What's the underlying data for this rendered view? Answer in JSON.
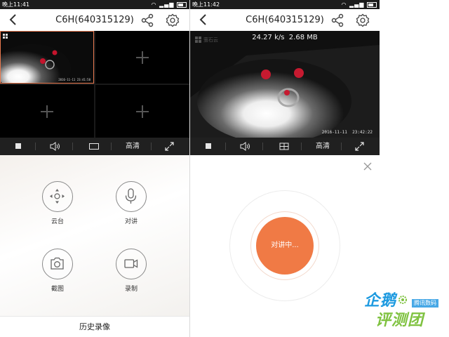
{
  "left_screen": {
    "status": {
      "time": "晚上11:41"
    },
    "header": {
      "title": "C6H(640315129)"
    },
    "video_grid": {
      "timestamp": "2016-11-11 23:41:58"
    },
    "toolbar": {
      "quality_label": "高清"
    },
    "controls": [
      {
        "label": "云台",
        "icon": "ptz-direction-icon"
      },
      {
        "label": "对讲",
        "icon": "microphone-icon"
      },
      {
        "label": "截图",
        "icon": "camera-icon"
      },
      {
        "label": "录制",
        "icon": "video-record-icon"
      }
    ],
    "history_label": "历史录像"
  },
  "right_screen": {
    "status": {
      "time": "晚上11:42"
    },
    "header": {
      "title": "C6H(640315129)"
    },
    "video": {
      "stats": "24.27 k/s  2.68 MB",
      "timestamp": "2016-11-11  23:42:22",
      "watermark": "萤石云"
    },
    "toolbar": {
      "quality_label": "高清"
    },
    "talk_button_label": "对讲中..."
  },
  "brand": {
    "line1": "企鹅",
    "line2": "评测团",
    "tag": "腾讯数码"
  },
  "colors": {
    "accent_orange": "#f07a45",
    "selected_border": "#e9794f",
    "toolbar_bg": "#202020"
  }
}
